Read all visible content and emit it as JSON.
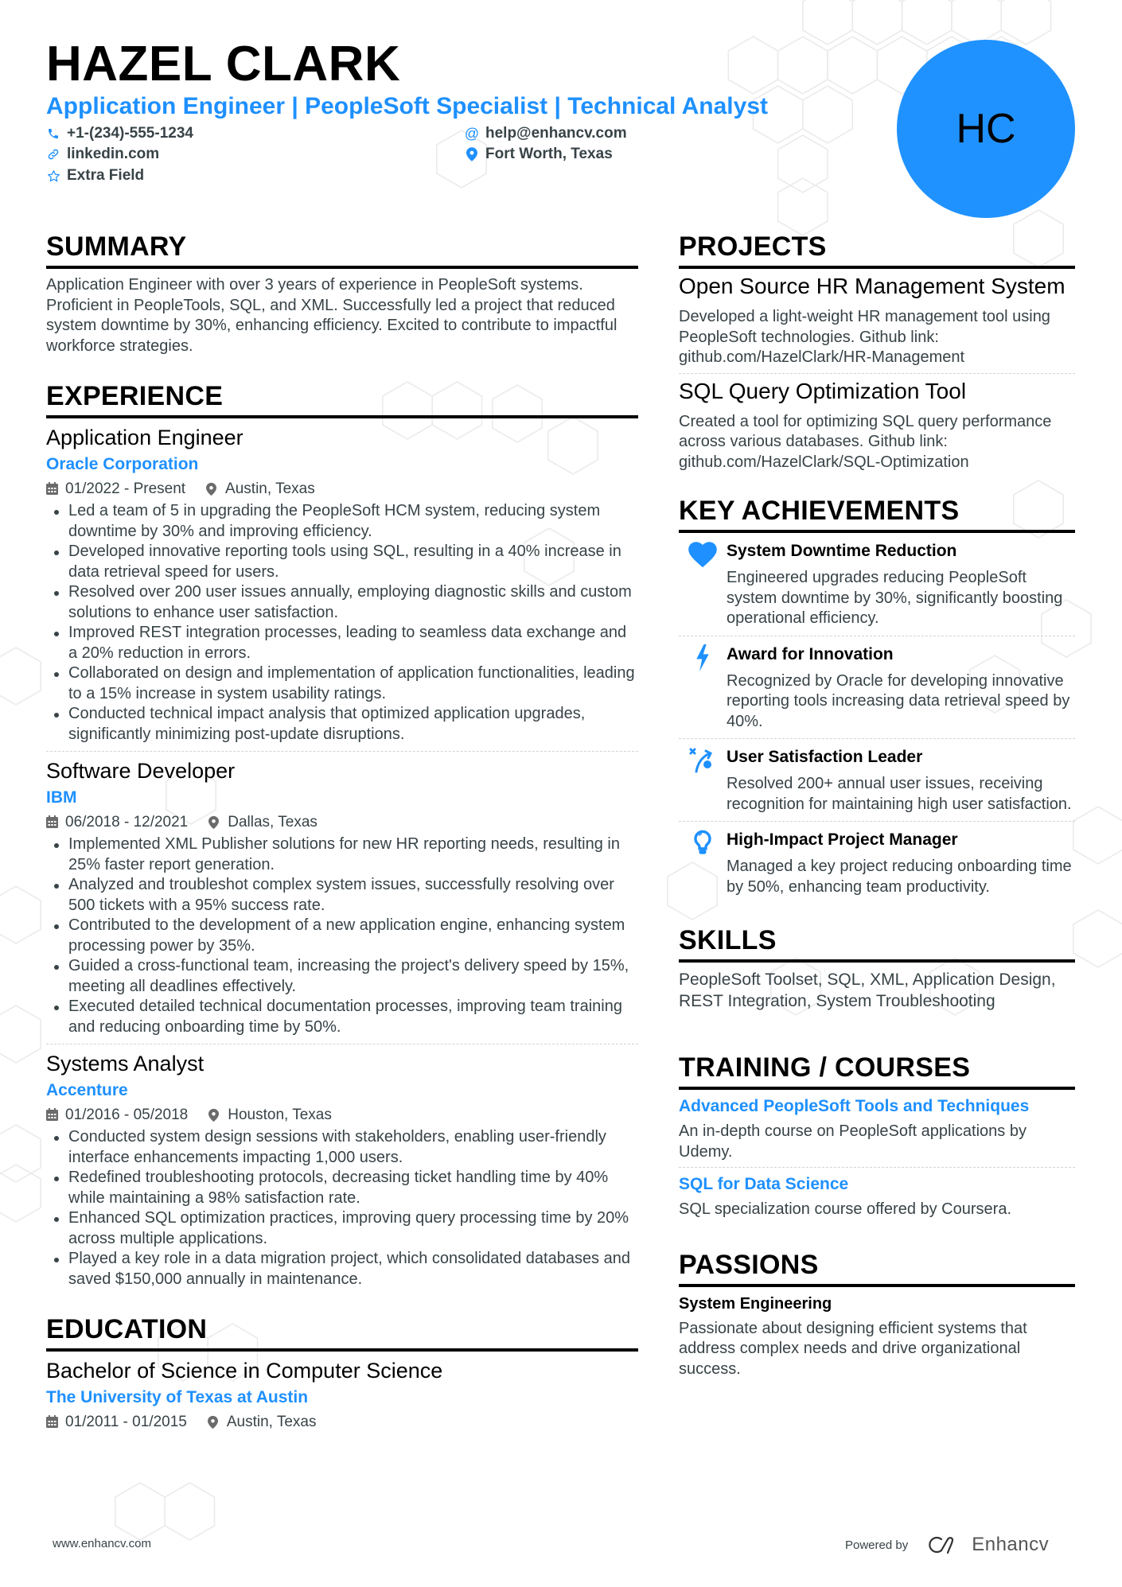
{
  "header": {
    "name": "HAZEL CLARK",
    "title": "Application Engineer | PeopleSoft Specialist | Technical Analyst",
    "phone": "+1-(234)-555-1234",
    "email": "help@enhancv.com",
    "linkedin": "linkedin.com",
    "location": "Fort Worth, Texas",
    "extra": "Extra Field",
    "initials": "HC"
  },
  "colors": {
    "accent": "#1e90ff",
    "text": "#384347",
    "heading": "#000000"
  },
  "summary": {
    "heading": "SUMMARY",
    "text": "Application Engineer with over 3 years of experience in PeopleSoft systems. Proficient in PeopleTools, SQL, and XML. Successfully led a project that reduced system downtime by 30%, enhancing efficiency. Excited to contribute to impactful workforce strategies."
  },
  "experience": {
    "heading": "EXPERIENCE",
    "jobs": [
      {
        "title": "Application Engineer",
        "company": "Oracle Corporation",
        "dates": "01/2022 - Present",
        "location": "Austin, Texas",
        "bullets": [
          "Led a team of 5 in upgrading the PeopleSoft HCM system, reducing system downtime by 30% and improving efficiency.",
          "Developed innovative reporting tools using SQL, resulting in a 40% increase in data retrieval speed for users.",
          "Resolved over 200 user issues annually, employing diagnostic skills and custom solutions to enhance user satisfaction.",
          "Improved REST integration processes, leading to seamless data exchange and a 20% reduction in errors.",
          "Collaborated on design and implementation of application functionalities, leading to a 15% increase in system usability ratings.",
          "Conducted technical impact analysis that optimized application upgrades, significantly minimizing post-update disruptions."
        ]
      },
      {
        "title": "Software Developer",
        "company": "IBM",
        "dates": "06/2018 - 12/2021",
        "location": "Dallas, Texas",
        "bullets": [
          "Implemented XML Publisher solutions for new HR reporting needs, resulting in 25% faster report generation.",
          "Analyzed and troubleshot complex system issues, successfully resolving over 500 tickets with a 95% success rate.",
          "Contributed to the development of a new application engine, enhancing system processing power by 35%.",
          "Guided a cross-functional team, increasing the project's delivery speed by 15%, meeting all deadlines effectively.",
          "Executed detailed technical documentation processes, improving team training and reducing onboarding time by 50%."
        ]
      },
      {
        "title": "Systems Analyst",
        "company": "Accenture",
        "dates": "01/2016 - 05/2018",
        "location": "Houston, Texas",
        "bullets": [
          "Conducted system design sessions with stakeholders, enabling user-friendly interface enhancements impacting 1,000 users.",
          "Redefined troubleshooting protocols, decreasing ticket handling time by 40% while maintaining a 98% satisfaction rate.",
          "Enhanced SQL optimization practices, improving query processing time by 20% across multiple applications.",
          "Played a key role in a data migration project, which consolidated databases and saved $150,000 annually in maintenance."
        ]
      }
    ]
  },
  "education": {
    "heading": "EDUCATION",
    "degree": "Bachelor of Science in Computer Science",
    "school": "The University of Texas at Austin",
    "dates": "01/2011 - 01/2015",
    "location": "Austin, Texas"
  },
  "projects": {
    "heading": "PROJECTS",
    "items": [
      {
        "title": "Open Source HR Management System",
        "description": "Developed a light-weight HR management tool using PeopleSoft technologies. Github link: github.com/HazelClark/HR-Management"
      },
      {
        "title": "SQL Query Optimization Tool",
        "description": "Created a tool for optimizing SQL query performance across various databases. Github link: github.com/HazelClark/SQL-Optimization"
      }
    ]
  },
  "achievements": {
    "heading": "KEY ACHIEVEMENTS",
    "items": [
      {
        "icon": "heart-icon",
        "title": "System Downtime Reduction",
        "description": "Engineered upgrades reducing PeopleSoft system downtime by 30%, significantly boosting operational efficiency."
      },
      {
        "icon": "lightning-icon",
        "title": "Award for Innovation",
        "description": "Recognized by Oracle for developing innovative reporting tools increasing data retrieval speed by 40%."
      },
      {
        "icon": "strategy-icon",
        "title": "User Satisfaction Leader",
        "description": "Resolved 200+ annual user issues, receiving recognition for maintaining high user satisfaction."
      },
      {
        "icon": "lightbulb-icon",
        "title": "High-Impact Project Manager",
        "description": "Managed a key project reducing onboarding time by 50%, enhancing team productivity."
      }
    ]
  },
  "skills": {
    "heading": "SKILLS",
    "text": "PeopleSoft Toolset, SQL, XML, Application Design, REST Integration, System Troubleshooting"
  },
  "training": {
    "heading": "TRAINING / COURSES",
    "items": [
      {
        "title": "Advanced PeopleSoft Tools and Techniques",
        "description": "An in-depth course on PeopleSoft applications by Udemy."
      },
      {
        "title": "SQL for Data Science",
        "description": "SQL specialization course offered by Coursera."
      }
    ]
  },
  "passions": {
    "heading": "PASSIONS",
    "title": "System Engineering",
    "description": "Passionate about designing efficient systems that address complex needs and drive organizational success."
  },
  "footer": {
    "website": "www.enhancv.com",
    "powered_by": "Powered by",
    "brand": "Enhancv"
  }
}
